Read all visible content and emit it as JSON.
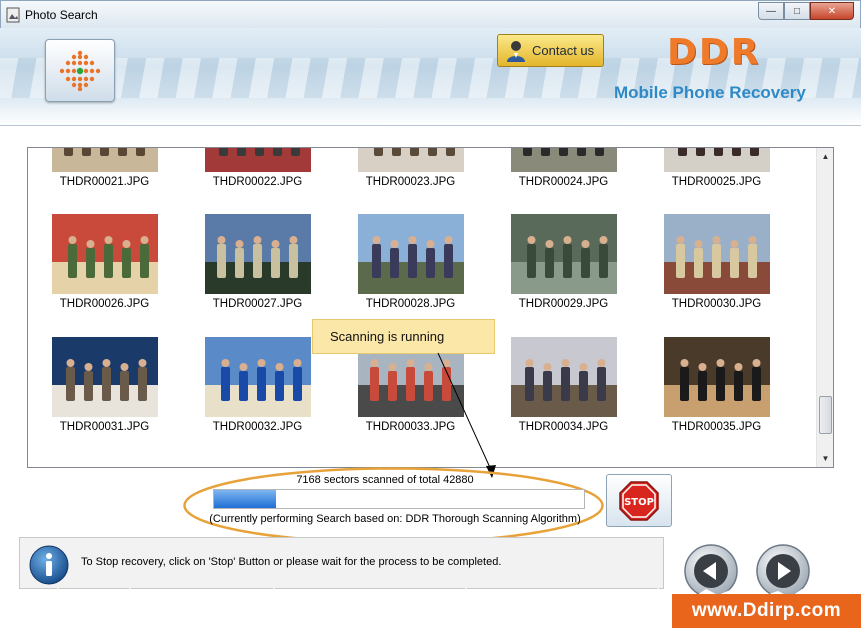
{
  "window": {
    "title": "Photo Search",
    "minimize_glyph": "—",
    "maximize_glyph": "□",
    "close_glyph": "✕"
  },
  "header": {
    "contact_label": "Contact us",
    "brand": "DDR",
    "subtitle": "Mobile Phone Recovery"
  },
  "files": [
    "THDR00021.JPG",
    "THDR00022.JPG",
    "THDR00023.JPG",
    "THDR00024.JPG",
    "THDR00025.JPG",
    "THDR00026.JPG",
    "THDR00027.JPG",
    "THDR00028.JPG",
    "THDR00029.JPG",
    "THDR00030.JPG",
    "THDR00031.JPG",
    "THDR00032.JPG",
    "THDR00033.JPG",
    "THDR00034.JPG",
    "THDR00035.JPG"
  ],
  "tooltip": "Scanning is running",
  "progress": {
    "scanned_text": "7168 sectors scanned of total 42880",
    "scanned": 7168,
    "total": 42880,
    "algorithm_text": "(Currently performing Search based on:  DDR Thorough Scanning Algorithm)"
  },
  "stop_label": "STOP",
  "status_message": "To Stop recovery, click on 'Stop' Button or please wait for the process to be completed.",
  "website": "www.Ddirp.com",
  "colors": {
    "brand_orange": "#ee7a2a",
    "subtitle_blue": "#2d8ac8",
    "progress_blue": "#1f6fd6",
    "tooltip_bg": "#fbe7a8",
    "ellipse_orange": "#e8a23a"
  },
  "icons": {
    "app": "photo-icon",
    "logo": "dot-matrix-logo-icon",
    "contact": "person-icon",
    "stop": "stop-sign-icon",
    "info": "info-icon",
    "back": "back-arrow-icon",
    "forward": "forward-arrow-icon"
  }
}
